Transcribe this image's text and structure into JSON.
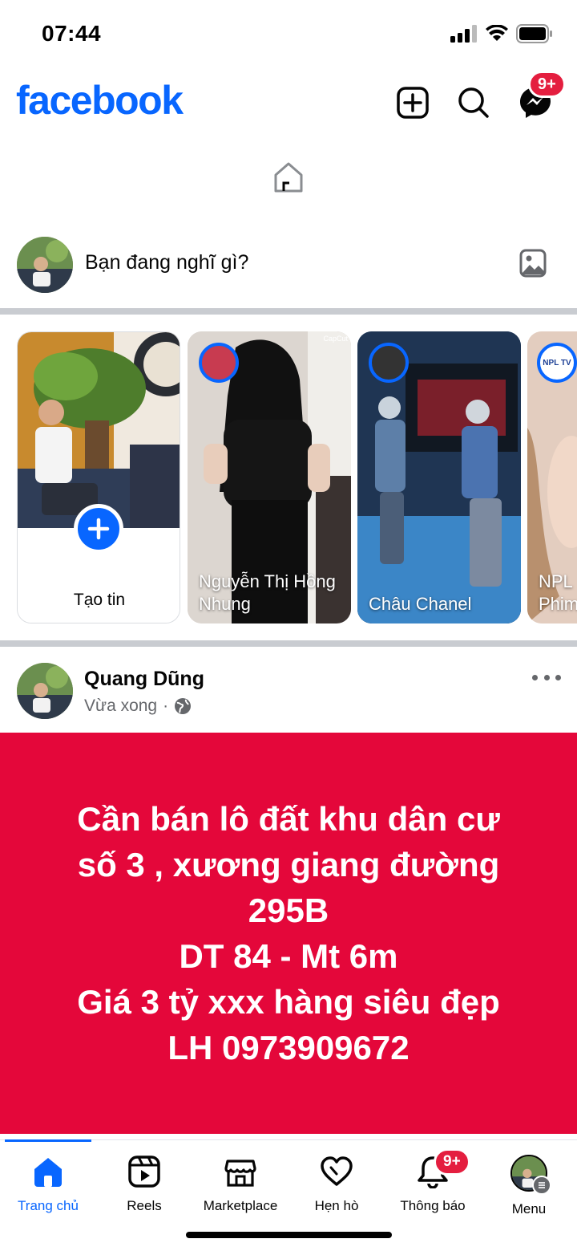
{
  "status_bar": {
    "time": "07:44"
  },
  "header": {
    "logo": "facebook",
    "messenger_badge": "9+"
  },
  "composer": {
    "placeholder": "Bạn đang nghĩ gì?"
  },
  "stories": [
    {
      "name": "Tạo tin"
    },
    {
      "name": "Nguyễn Thị Hồng Nhung",
      "tag": "CapCut"
    },
    {
      "name": "Châu Chanel"
    },
    {
      "name": "NPL Phim",
      "tag": "NPL TV"
    }
  ],
  "post": {
    "author": "Quang Dũng",
    "time": "Vừa xong",
    "separator": "·",
    "text_lines": [
      "Cần bán lô đất khu dân cư",
      "số 3 , xương giang đường",
      "295B",
      "DT 84 - Mt 6m",
      "Giá 3 tỷ xxx hàng siêu đẹp",
      "LH 0973909672"
    ],
    "bg_color": "#e4073a"
  },
  "nav": {
    "items": [
      {
        "label": "Trang chủ",
        "active": true
      },
      {
        "label": "Reels"
      },
      {
        "label": "Marketplace"
      },
      {
        "label": "Hẹn hò"
      },
      {
        "label": "Thông báo",
        "badge": "9+"
      },
      {
        "label": "Menu"
      }
    ]
  },
  "colors": {
    "brand": "#0866ff",
    "badge": "#e41e3f"
  }
}
